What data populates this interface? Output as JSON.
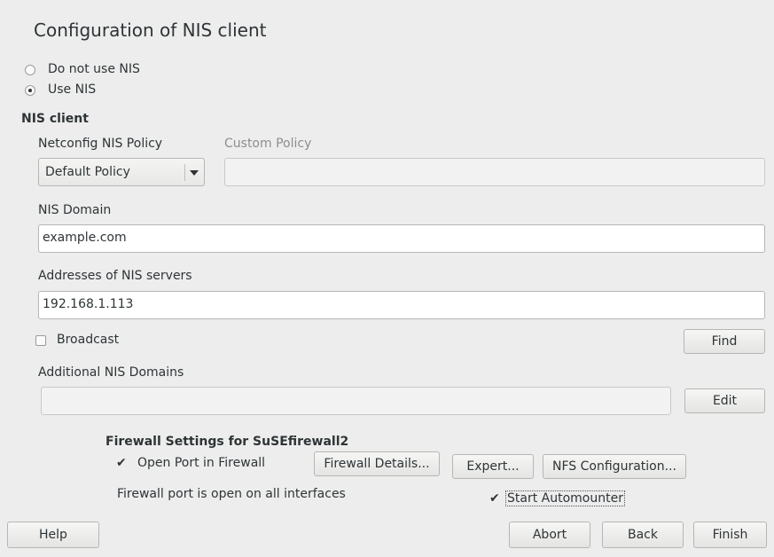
{
  "title": "Configuration of NIS client",
  "nis_mode": {
    "options": [
      {
        "label": "Do not use NIS",
        "selected": false
      },
      {
        "label": "Use NIS",
        "selected": true
      }
    ]
  },
  "nis_client": {
    "heading": "NIS client",
    "policy_label": "Netconfig NIS Policy",
    "policy_value": "Default Policy",
    "custom_policy_label": "Custom Policy",
    "custom_policy_value": "",
    "domain_label": "NIS Domain",
    "domain_value": "example.com",
    "servers_label": "Addresses of NIS servers",
    "servers_value": "192.168.1.113",
    "broadcast_label": "Broadcast",
    "broadcast_checked": false,
    "find_label": "Find",
    "additional_domains_label": "Additional NIS Domains",
    "additional_domains_value": "",
    "edit_label": "Edit"
  },
  "firewall": {
    "heading": "Firewall Settings for SuSEfirewall2",
    "open_port_label": "Open Port in Firewall",
    "open_port_checked": true,
    "details_label": "Firewall Details...",
    "status_text": "Firewall port is open on all interfaces"
  },
  "expert_label": "Expert...",
  "nfs_label": "NFS Configuration...",
  "automounter_label": "Start Automounter",
  "automounter_checked": true,
  "footer": {
    "help": "Help",
    "abort": "Abort",
    "back": "Back",
    "finish": "Finish"
  }
}
